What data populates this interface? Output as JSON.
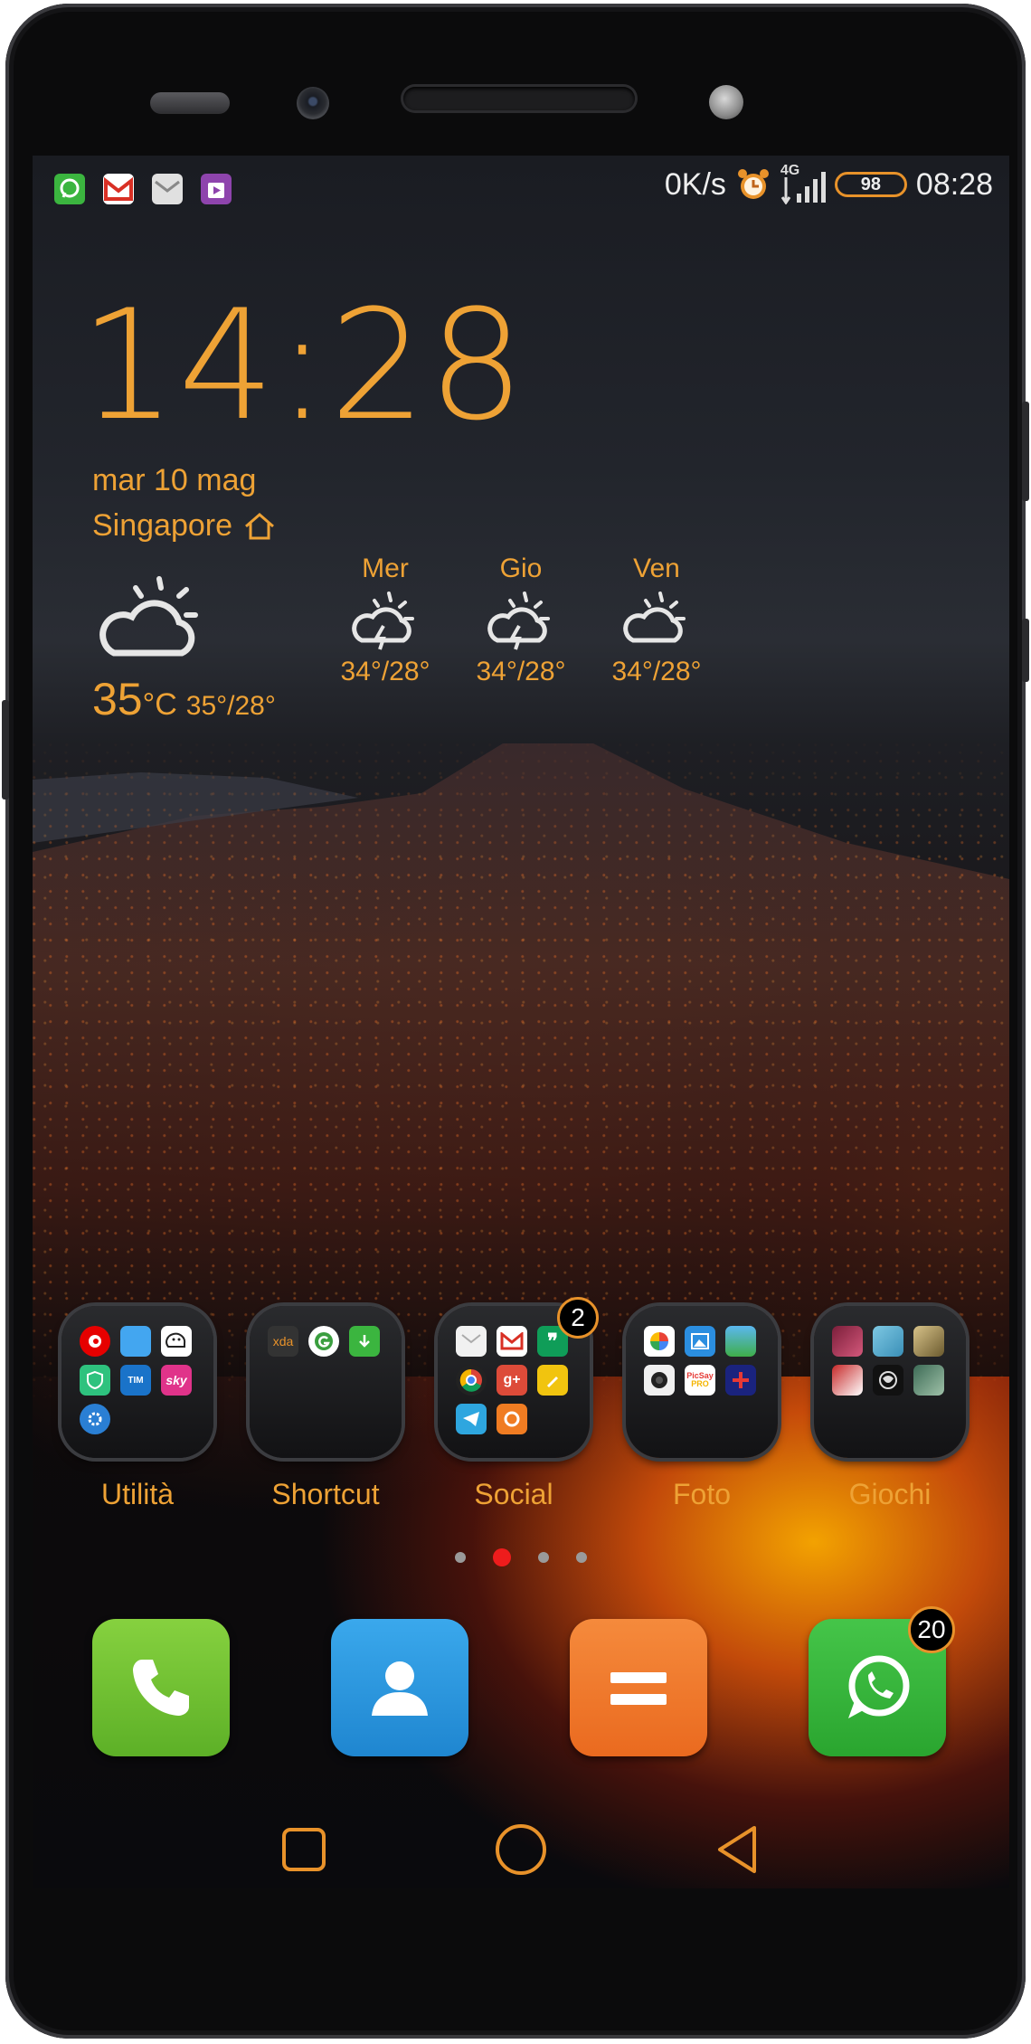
{
  "status_bar": {
    "notifications": [
      "whatsapp-icon",
      "gmail-icon",
      "email-icon",
      "play-store-icon"
    ],
    "network_speed": "0K/s",
    "network_type": "4G",
    "battery": "98",
    "time": "08:28"
  },
  "clock_widget": {
    "time": "14:28",
    "date": "mar 10 mag",
    "city": "Singapore"
  },
  "weather": {
    "current": {
      "temp": "35",
      "unit": "°C",
      "range": "35°/28°",
      "condition_icon": "partly-cloudy-icon"
    },
    "forecast": [
      {
        "day": "Mer",
        "range": "34°/28°",
        "icon": "thunderstorm-icon"
      },
      {
        "day": "Gio",
        "range": "34°/28°",
        "icon": "thunderstorm-icon"
      },
      {
        "day": "Ven",
        "range": "34°/28°",
        "icon": "partly-cloudy-icon"
      }
    ]
  },
  "folders": [
    {
      "label": "Utilità",
      "apps": [
        "vodafone",
        "files",
        "waze",
        "security",
        "tim",
        "sky",
        "gear"
      ]
    },
    {
      "label": "Shortcut",
      "apps": [
        "xda",
        "greenify",
        "download"
      ]
    },
    {
      "label": "Social",
      "badge": "2",
      "apps": [
        "email",
        "gmail",
        "hangouts",
        "chrome",
        "google-plus",
        "keep",
        "telegram",
        "orange"
      ]
    },
    {
      "label": "Foto",
      "apps": [
        "photos",
        "gallery",
        "landscape",
        "camera",
        "picsay-pro",
        "cross"
      ]
    },
    {
      "label": "Giochi",
      "apps": [
        "game1",
        "game2",
        "game3",
        "game4",
        "game5",
        "game6"
      ]
    }
  ],
  "mini_text": {
    "xda": "xda",
    "sky": "sky",
    "tim": "TIM",
    "picsay": "PicSay",
    "pro": "PRO",
    "gplus": "g+",
    "hangouts": "❞"
  },
  "page_indicator": {
    "count": 4,
    "active": 1
  },
  "dock": [
    {
      "name": "phone",
      "color": "#6cc12f"
    },
    {
      "name": "contacts",
      "color": "#2a9ae0"
    },
    {
      "name": "calculator",
      "color": "#f0762c"
    },
    {
      "name": "whatsapp",
      "color": "#33b437",
      "badge": "20"
    }
  ],
  "colors": {
    "accent": "#eea235",
    "badge_border": "#e8922a",
    "active_dot": "#ee1c1c"
  }
}
